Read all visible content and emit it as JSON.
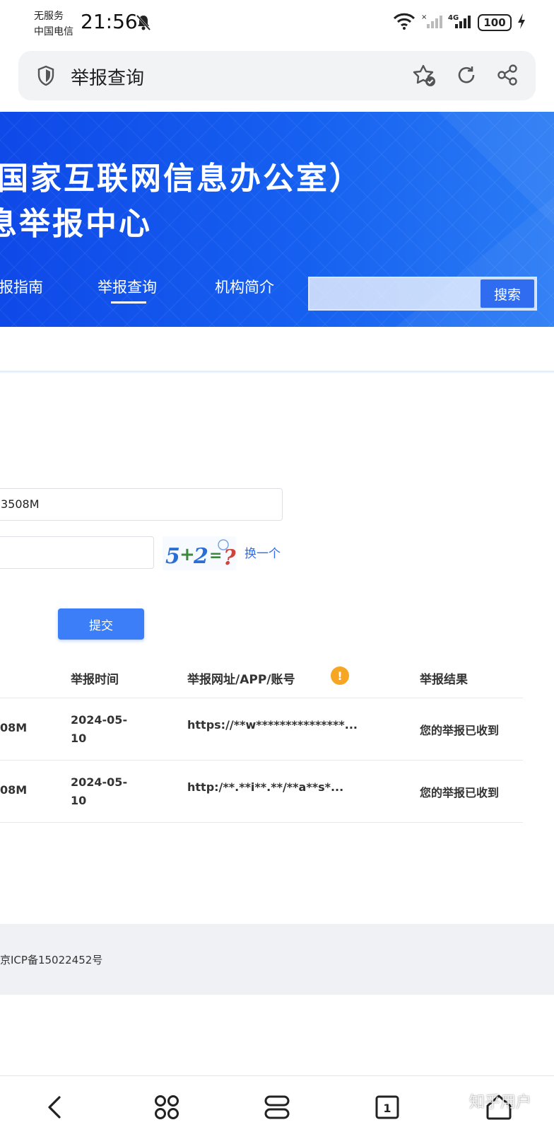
{
  "status_bar": {
    "carrier_line_1": "无服务",
    "carrier_line_2": "中国电信",
    "time": "21:56",
    "network": "4G",
    "battery": "100"
  },
  "address_bar": {
    "title": "举报查询"
  },
  "banner": {
    "title_line_1": "国家互联网信息办公室）",
    "title_line_2": "息举报中心",
    "nav": [
      {
        "label": "报指南"
      },
      {
        "label": "举报查询",
        "active": true
      },
      {
        "label": "机构简介"
      }
    ],
    "search_button": "搜索"
  },
  "form": {
    "query_value": "3508M",
    "captcha_text": "5+2=?",
    "refresh_link": "换一个",
    "submit_label": "提交"
  },
  "table": {
    "headers": [
      "举报时间",
      "举报网址/APP/账号",
      "举报结果"
    ],
    "rows": [
      {
        "id": "08M",
        "date": "2024-05-10",
        "target": "https://**w***************...",
        "result": "您的举报已收到"
      },
      {
        "id": "08M",
        "date": "2024-05-10",
        "target": "http:/**.**i**.**/**a**s*...",
        "result": "您的举报已收到"
      }
    ]
  },
  "footer": {
    "icp": "京ICP备15022452号"
  },
  "watermark": "知乎用户",
  "colors": {
    "brand_blue": "#1660f0",
    "button_blue": "#3b7ef7",
    "warning": "#f6a623"
  }
}
